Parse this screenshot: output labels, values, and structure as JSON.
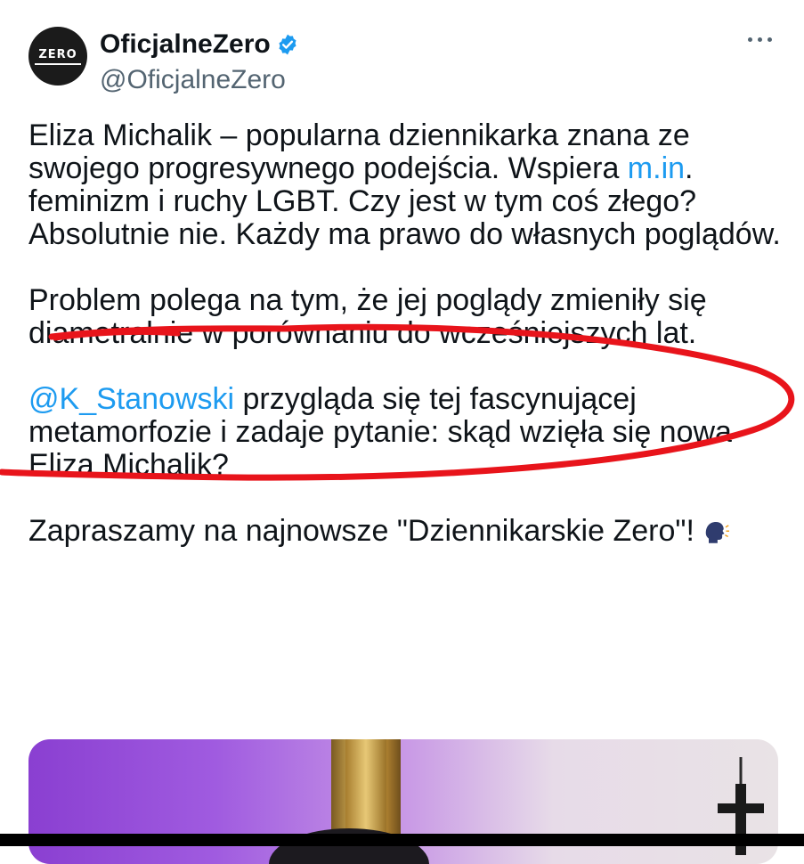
{
  "tweet": {
    "author": {
      "display_name": "OficjalneZero",
      "handle": "@OficjalneZero",
      "avatar_text": "ZERO",
      "verified_icon": "verified-badge-icon",
      "verified_color": "#1d9bf0"
    },
    "more_icon": "more-options-icon",
    "body": {
      "p1": "Eliza Michalik – popularna dziennikarka znana ze swojego progresywnego podejścia. Wspiera ",
      "p1_link": "m.in",
      "p1_rest": ". feminizm i ruchy LGBT. Czy jest w tym coś złego? Absolutnie nie. Każdy ma prawo do własnych poglądów.",
      "p2": "Problem polega na tym, że jej poglądy zmieniły się diametralnie w porównaniu do wcześniejszych lat.",
      "p3_mention": "@K_Stanowski",
      "p3_rest": " przygląda się tej fascynującej metamorfozie i zadaje pytanie: skąd wzięła się nowa Eliza Michalik?",
      "p4": "Zapraszamy na najnowsze \"Dziennikarskie Zero\"!",
      "p4_emoji": "speaking-head-emoji"
    },
    "link_color": "#1d9bf0",
    "annotation_color": "#e8141b"
  }
}
